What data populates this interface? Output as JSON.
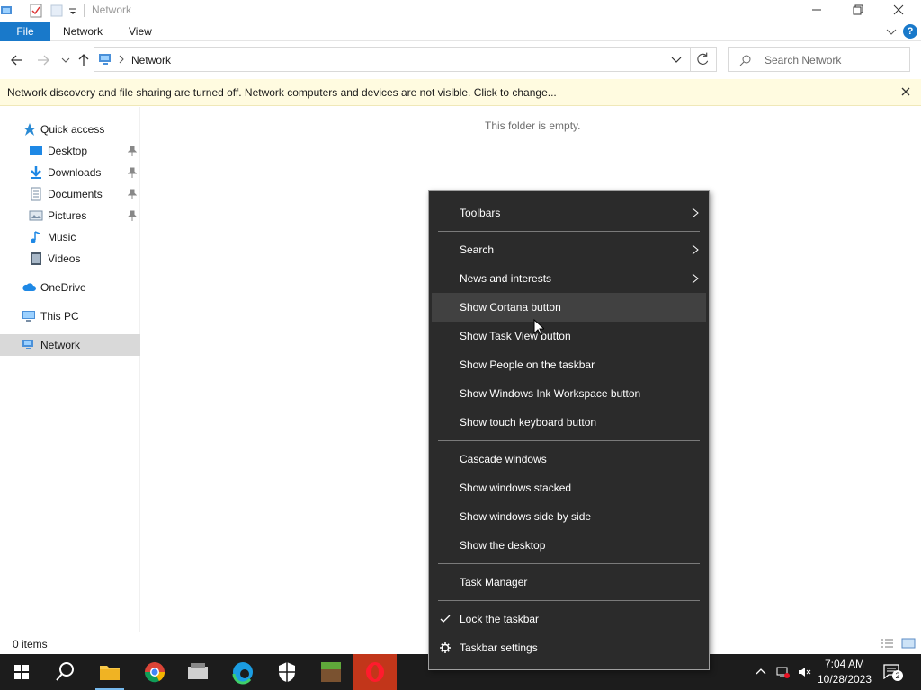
{
  "window": {
    "title": "Network",
    "ribbon_tabs": [
      "File",
      "Network",
      "View"
    ]
  },
  "address": {
    "path": "Network",
    "search_placeholder": "Search Network"
  },
  "infobar": {
    "message": "Network discovery and file sharing are turned off. Network computers and devices are not visible. Click to change..."
  },
  "sidebar": {
    "quick_access": "Quick access",
    "items": [
      "Desktop",
      "Downloads",
      "Documents",
      "Pictures",
      "Music",
      "Videos"
    ],
    "onedrive": "OneDrive",
    "this_pc": "This PC",
    "network": "Network"
  },
  "content": {
    "empty_text": "This folder is empty."
  },
  "statusbar": {
    "item_count": "0 items"
  },
  "context_menu": {
    "items": [
      "Toolbars",
      "Search",
      "News and interests",
      "Show Cortana button",
      "Show Task View button",
      "Show People on the taskbar",
      "Show Windows Ink Workspace button",
      "Show touch keyboard button",
      "Cascade windows",
      "Show windows stacked",
      "Show windows side by side",
      "Show the desktop",
      "Task Manager",
      "Lock the taskbar",
      "Taskbar settings"
    ]
  },
  "taskbar": {
    "time": "7:04 AM",
    "date": "10/28/2023",
    "notification_count": "2"
  },
  "colors": {
    "accent": "#1979ca",
    "menu_bg": "#2b2b2b",
    "taskbar_bg": "#1c1c1c",
    "infobar_bg": "#fffbe0"
  }
}
